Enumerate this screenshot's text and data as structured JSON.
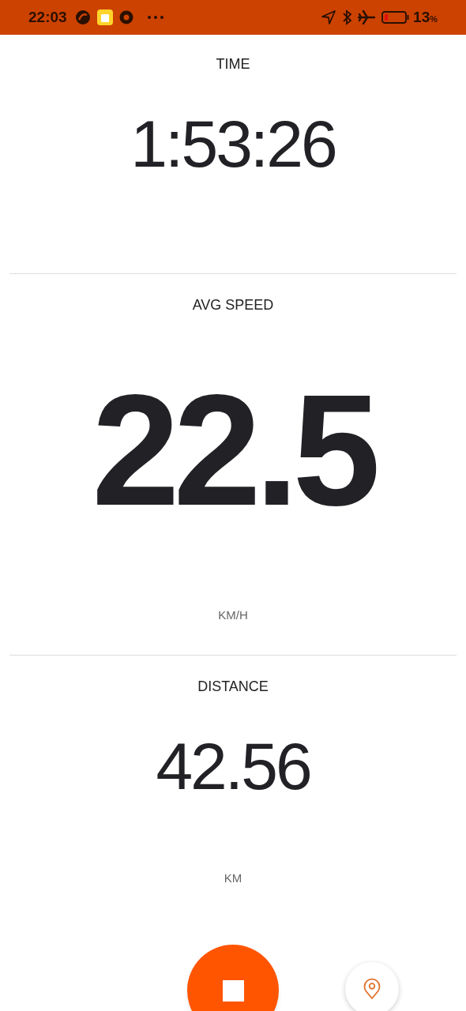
{
  "status_bar": {
    "time": "22:03",
    "battery": "13",
    "battery_unit": "%"
  },
  "metrics": [
    {
      "label": "TIME",
      "value": "1:53:26",
      "kind": "standard"
    },
    {
      "label": "AVG SPEED",
      "value": "22.5",
      "unit": "KM/H",
      "kind": "hero"
    },
    {
      "label": "DISTANCE",
      "value": "42.56",
      "unit": "KM",
      "kind": "standard"
    }
  ]
}
